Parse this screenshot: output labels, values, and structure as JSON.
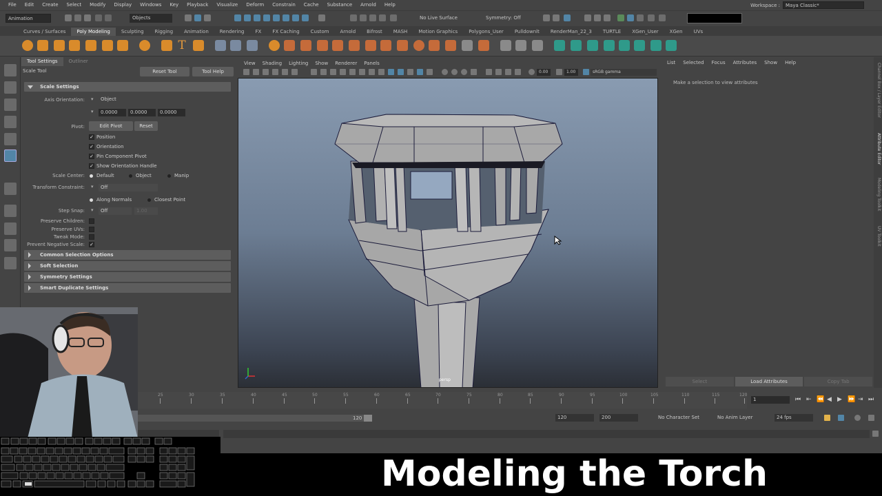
{
  "menubar": {
    "items": [
      "File",
      "Edit",
      "Create",
      "Select",
      "Modify",
      "Display",
      "Windows",
      "Key",
      "Playback",
      "Visualize",
      "Deform",
      "Constrain",
      "Cache",
      "Substance",
      "Arnold",
      "Help"
    ],
    "workspace_label": "Workspace :",
    "workspace_value": "Maya Classic*"
  },
  "statusline": {
    "menu_set": "Animation",
    "selection_mask": "Objects",
    "live_surface": "No Live Surface",
    "symmetry": "Symmetry: Off"
  },
  "shelf": {
    "tabs": [
      "Curves / Surfaces",
      "Poly Modeling",
      "Sculpting",
      "Rigging",
      "Animation",
      "Rendering",
      "FX",
      "FX Caching",
      "Custom",
      "Arnold",
      "Bifrost",
      "MASH",
      "Motion Graphics",
      "Polygons_User",
      "Pulldownlt",
      "RenderMan_22_3",
      "TURTLE",
      "XGen_User",
      "XGen",
      "UVs"
    ],
    "active_tab": "Poly Modeling"
  },
  "tool_settings": {
    "tabs": [
      "Tool Settings",
      "Outliner"
    ],
    "tool_name": "Scale Tool",
    "reset_label": "Reset Tool",
    "help_label": "Tool Help",
    "section_scale": "Scale Settings",
    "axis_orientation_label": "Axis Orientation:",
    "axis_orientation_value": "Object",
    "axis_values": [
      "0.0000",
      "0.0000",
      "0.0000"
    ],
    "pivot_label": "Pivot:",
    "edit_pivot_label": "Edit Pivot",
    "pivot_reset_label": "Reset",
    "pivot_checks": [
      "Position",
      "Orientation",
      "Pin Component Pivot",
      "Show Orientation Handle"
    ],
    "scale_center_label": "Scale Center:",
    "scale_center_options": [
      "Default",
      "Object",
      "Manip"
    ],
    "transform_constraint_label": "Transform Constraint:",
    "transform_constraint_value": "Off",
    "constraint_options": [
      "Along Normals",
      "Closest Point"
    ],
    "step_snap_label": "Step Snap:",
    "step_snap_value": "Off",
    "step_snap_amount": "1.00",
    "preserve_children": "Preserve Children:",
    "preserve_uvs": "Preserve UVs:",
    "tweak_mode": "Tweak Mode:",
    "prevent_negative": "Prevent Negative Scale:",
    "frames": [
      "Common Selection Options",
      "Soft Selection",
      "Symmetry Settings",
      "Smart Duplicate Settings"
    ]
  },
  "viewport": {
    "menus": [
      "View",
      "Shading",
      "Lighting",
      "Show",
      "Renderer",
      "Panels"
    ],
    "exposure": "0.00",
    "gamma": "1.00",
    "color_space": "sRGB gamma",
    "camera": "persp"
  },
  "attribute_editor": {
    "menus": [
      "List",
      "Selected",
      "Focus",
      "Attributes",
      "Show",
      "Help"
    ],
    "message": "Make a selection to view attributes",
    "buttons": [
      "Select",
      "Load Attributes",
      "Copy Tab"
    ],
    "side_tabs": [
      "Channel Box / Layer Editor",
      "Attribute Editor",
      "Modeling Toolkit",
      "UV Toolkit"
    ]
  },
  "timeline": {
    "ticks": [
      "20",
      "25",
      "30",
      "35",
      "40",
      "45",
      "50",
      "55",
      "60",
      "65",
      "70",
      "75",
      "80",
      "85",
      "90",
      "95",
      "100",
      "105",
      "110",
      "115",
      "120"
    ],
    "current_frame": "1"
  },
  "range": {
    "end_label": "120",
    "playback_end": "120",
    "animation_end": "200",
    "character_set": "No Character Set",
    "anim_layer": "No Anim Layer",
    "fps": "24 fps"
  },
  "caption": {
    "text": "Modeling the Torch"
  },
  "colors": {
    "ui_bg": "#444444",
    "field_bg": "#2b2b2b",
    "viewport_top": "#899bb1",
    "viewport_bottom": "#2b2f36",
    "accent_blue": "#5285a6",
    "caption_bg": "#000000"
  }
}
